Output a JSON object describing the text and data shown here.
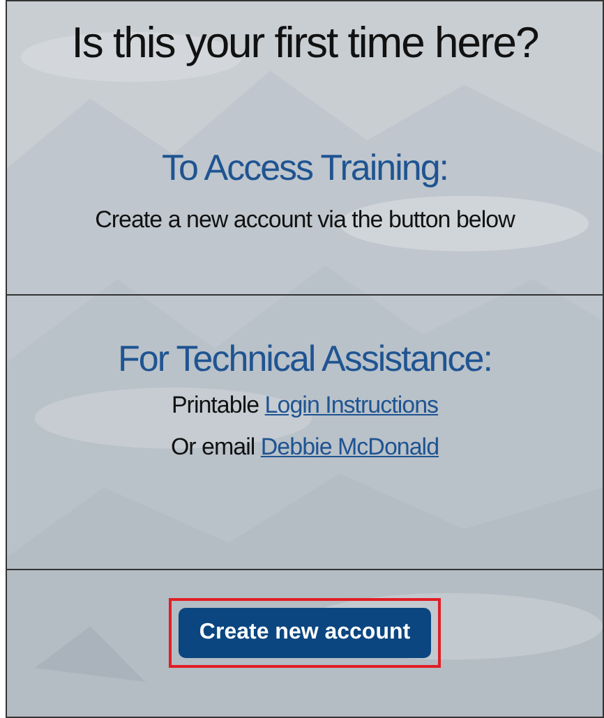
{
  "heading": "Is this your first time here?",
  "sections": [
    {
      "title": "To Access Training:",
      "lines": [
        [
          {
            "kind": "text",
            "text": "Create a new account via the button below"
          }
        ]
      ]
    },
    {
      "title": "For Technical Assistance:",
      "lines": [
        [
          {
            "kind": "text",
            "text": "Printable"
          },
          {
            "kind": "link",
            "text": "Login Instructions"
          }
        ],
        [
          {
            "kind": "text",
            "text": "Or email"
          },
          {
            "kind": "link",
            "text": "Debbie McDonald"
          }
        ]
      ]
    }
  ],
  "button": {
    "label": "Create new account",
    "highlighted": true
  }
}
